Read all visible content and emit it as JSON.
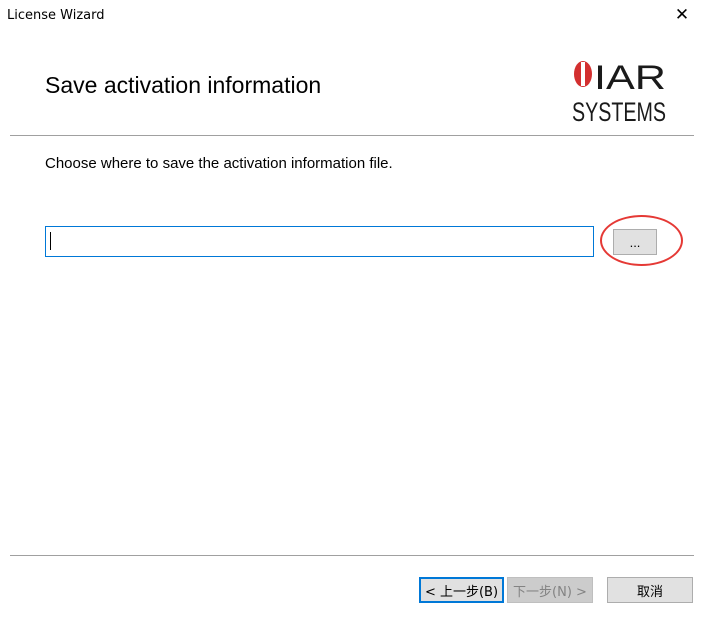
{
  "window": {
    "title": "License Wizard",
    "close_glyph": "✕"
  },
  "page": {
    "heading": "Save activation information",
    "instruction": "Choose where to save the activation information file."
  },
  "logo": {
    "brand_top": "IAR",
    "brand_bottom": "SYSTEMS",
    "accent_color": "#d32f2f",
    "icon": "iar-logo"
  },
  "file_path": {
    "value": "",
    "placeholder": ""
  },
  "browse_button": {
    "label": "..."
  },
  "highlight": {
    "color": "#e53935"
  },
  "footer": {
    "back_label": "< 上一步(B)",
    "next_label": "下一步(N) >",
    "cancel_label": "取消"
  }
}
